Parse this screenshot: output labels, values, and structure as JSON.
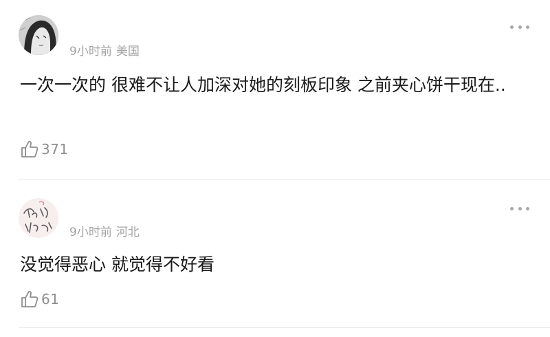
{
  "comments": [
    {
      "username": "",
      "time": "9小时前",
      "location": "美国",
      "text": "一次一次的 很难不让人加深对她的刻板印象 之前夹心饼干现在..",
      "likes": "371",
      "icons": {
        "avatar": "manga-character-avatar",
        "more": "more-dots-icon",
        "like": "thumbs-up-icon"
      }
    },
    {
      "username": "",
      "time": "9小时前",
      "location": "河北",
      "text": "没觉得恶心 就觉得不好看",
      "likes": "61",
      "icons": {
        "avatar": "handwriting-avatar",
        "more": "more-dots-icon",
        "like": "thumbs-up-icon"
      }
    }
  ]
}
